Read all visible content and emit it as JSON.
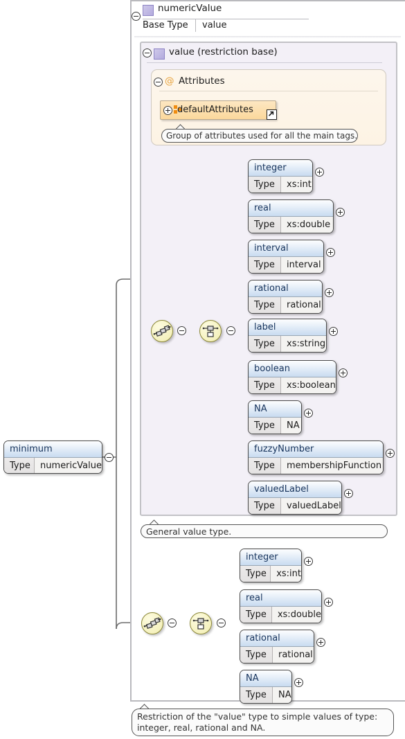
{
  "diagram": {
    "kind": "xsd-schema-diagram",
    "root_element": {
      "name": "minimum",
      "type_key": "Type",
      "type_value": "numericValue"
    },
    "type_definition": {
      "name": "numericValue",
      "icon": "complex-type-icon",
      "base_type_key": "Base Type",
      "base_type_value": "value"
    },
    "restriction_base": {
      "name": "value (restriction base)",
      "icon": "complex-type-icon",
      "attributes_group": {
        "label": "Attributes",
        "icon": "at-sign-icon",
        "items": [
          {
            "name": "defaultAttributes",
            "icon": "attribute-group-icon",
            "link_icon": "external-link-icon",
            "note": "Group of attributes used for all the main tags."
          }
        ]
      },
      "choice_elements": [
        {
          "name": "integer",
          "type_key": "Type",
          "type_value": "xs:int"
        },
        {
          "name": "real",
          "type_key": "Type",
          "type_value": "xs:double"
        },
        {
          "name": "interval",
          "type_key": "Type",
          "type_value": "interval"
        },
        {
          "name": "rational",
          "type_key": "Type",
          "type_value": "rational"
        },
        {
          "name": "label",
          "type_key": "Type",
          "type_value": "xs:string"
        },
        {
          "name": "boolean",
          "type_key": "Type",
          "type_value": "xs:boolean"
        },
        {
          "name": "NA",
          "type_key": "Type",
          "type_value": "NA"
        },
        {
          "name": "fuzzyNumber",
          "type_key": "Type",
          "type_value": "membershipFunction"
        },
        {
          "name": "valuedLabel",
          "type_key": "Type",
          "type_value": "valuedLabel"
        }
      ],
      "annotation": "General value type."
    },
    "restricted": {
      "choice_elements": [
        {
          "name": "integer",
          "type_key": "Type",
          "type_value": "xs:int"
        },
        {
          "name": "real",
          "type_key": "Type",
          "type_value": "xs:double"
        },
        {
          "name": "rational",
          "type_key": "Type",
          "type_value": "rational"
        },
        {
          "name": "NA",
          "type_key": "Type",
          "type_value": "NA"
        }
      ],
      "annotation_line1": "Restriction of the \"value\" type to simple values of type:",
      "annotation_line2": "integer, real, rational and NA."
    },
    "connectors": {
      "sequence_icon": "sequence-compositor-icon",
      "choice_icon": "choice-compositor-icon",
      "collapse_icon": "minus-circle-icon",
      "expand_icon": "plus-circle-icon"
    },
    "colors": {
      "element_header": "#c8dbf0",
      "type_container_border": "#b9b9bd",
      "value_container_bg": "#f3f0f7",
      "attributes_bg": "#fdf3e4",
      "attribute_group_box": "#fbd89c",
      "compositor_node": "#f2eeb0",
      "complex_type_icon": "#b3aade",
      "at_sign": "#e8a33d"
    }
  }
}
